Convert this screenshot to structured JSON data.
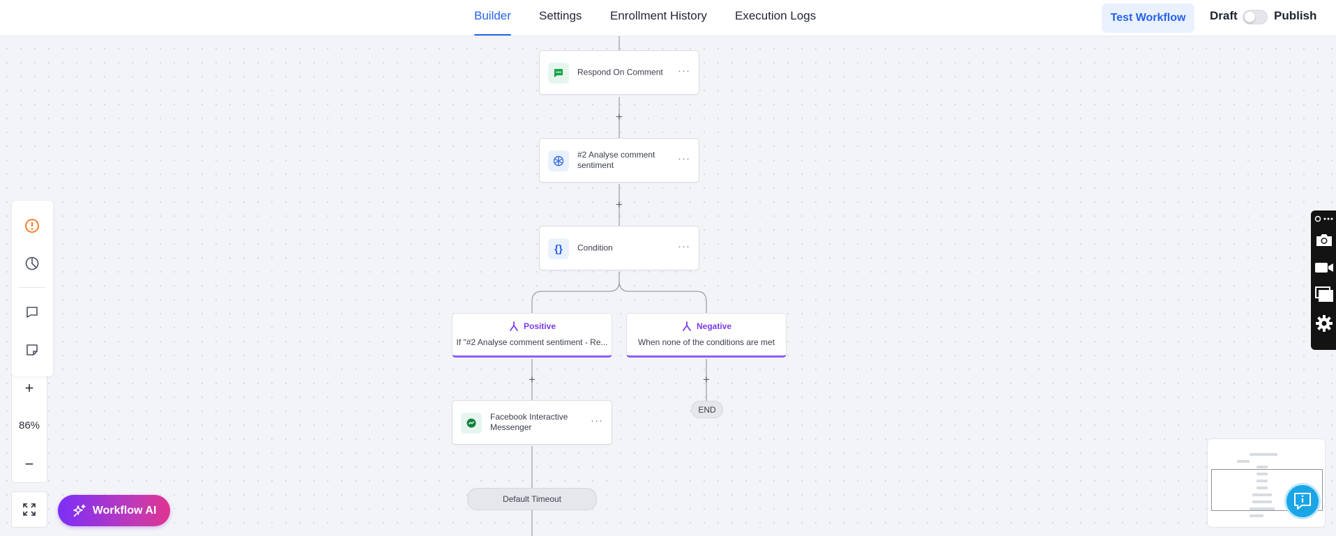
{
  "header": {
    "tabs": [
      {
        "label": "Builder",
        "active": true
      },
      {
        "label": "Settings",
        "active": false
      },
      {
        "label": "Enrollment History",
        "active": false
      },
      {
        "label": "Execution Logs",
        "active": false
      }
    ],
    "test_button": "Test Workflow",
    "draft_label": "Draft",
    "publish_label": "Publish",
    "publish_enabled": false
  },
  "canvas": {
    "nodes": [
      {
        "label": "Respond On Comment",
        "icon": "message-icon"
      },
      {
        "label": "#2 Analyse comment sentiment",
        "icon": "openai-icon"
      },
      {
        "label": "Condition",
        "icon": "braces-icon"
      },
      {
        "label": "Facebook Interactive Messenger",
        "icon": "messenger-icon"
      }
    ],
    "branches": [
      {
        "title": "Positive",
        "subtitle": "If \"#2 Analyse comment sentiment - Re..."
      },
      {
        "title": "Negative",
        "subtitle": "When none of the conditions are met"
      }
    ],
    "end_label": "END",
    "timeout_label": "Default Timeout",
    "add_symbol": "+"
  },
  "toolbar": {
    "zoom_in": "+",
    "zoom_level": "86%",
    "zoom_out": "−"
  },
  "ai_button": "Workflow AI",
  "colors": {
    "accent": "#2563eb",
    "branch": "#7c3aed",
    "warning": "#f97316"
  }
}
